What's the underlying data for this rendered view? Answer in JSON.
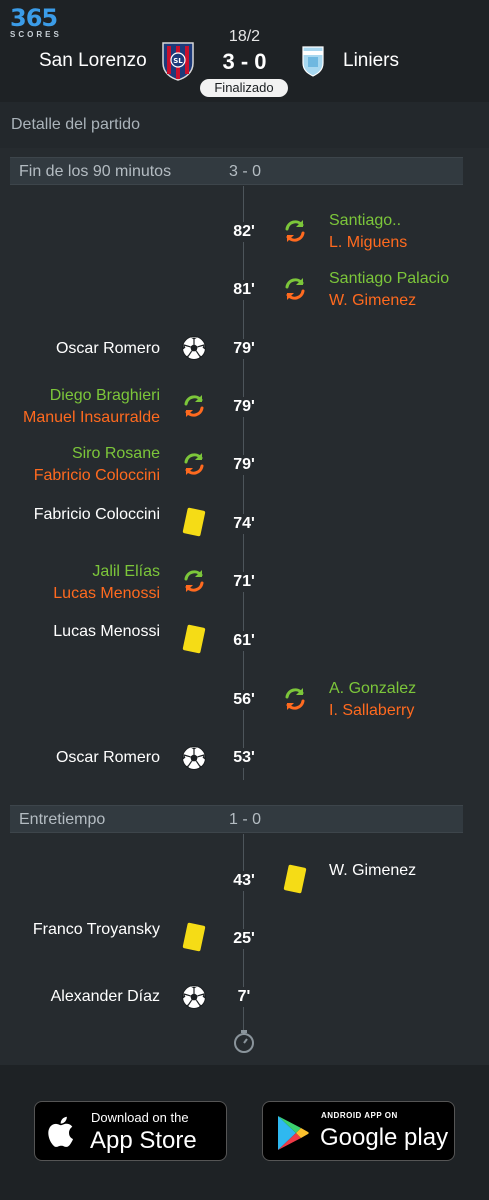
{
  "header": {
    "logo_number": "365",
    "logo_word": "SCORES",
    "date": "18/2",
    "score": "3 - 0",
    "status": "Finalizado",
    "home_team": "San Lorenzo",
    "away_team": "Liniers"
  },
  "section_title": "Detalle del partido",
  "periods": [
    {
      "label": "Fin de los 90 minutos",
      "score": "3 - 0"
    },
    {
      "label": "Entretiempo",
      "score": "1 - 0"
    }
  ],
  "events": [
    {
      "minute": "82'",
      "side": "away",
      "type": "substitution",
      "in": "Santiago..",
      "out": "L. Miguens"
    },
    {
      "minute": "81'",
      "side": "away",
      "type": "substitution",
      "in": "Santiago Palacio",
      "out": "W. Gimenez"
    },
    {
      "minute": "79'",
      "side": "home",
      "type": "goal",
      "player": "Oscar Romero"
    },
    {
      "minute": "79'",
      "side": "home",
      "type": "substitution",
      "in": "Diego Braghieri",
      "out": "Manuel Insaurralde"
    },
    {
      "minute": "79'",
      "side": "home",
      "type": "substitution",
      "in": "Siro Rosane",
      "out": "Fabricio Coloccini"
    },
    {
      "minute": "74'",
      "side": "home",
      "type": "yellow-card",
      "player": "Fabricio Coloccini"
    },
    {
      "minute": "71'",
      "side": "home",
      "type": "substitution",
      "in": "Jalil Elías",
      "out": "Lucas Menossi"
    },
    {
      "minute": "61'",
      "side": "home",
      "type": "yellow-card",
      "player": "Lucas Menossi"
    },
    {
      "minute": "56'",
      "side": "away",
      "type": "substitution",
      "in": "A. Gonzalez",
      "out": "I. Sallaberry"
    },
    {
      "minute": "53'",
      "side": "home",
      "type": "goal",
      "player": "Oscar Romero"
    },
    {
      "minute": "43'",
      "side": "away",
      "type": "yellow-card",
      "player": "W. Gimenez"
    },
    {
      "minute": "25'",
      "side": "home",
      "type": "yellow-card",
      "player": "Franco Troyansky"
    },
    {
      "minute": "7'",
      "side": "home",
      "type": "goal",
      "player": "Alexander Díaz"
    }
  ],
  "footer": {
    "app_store_small": "Download on the",
    "app_store_big": "App Store",
    "play_store_small": "ANDROID APP ON",
    "play_store_big": "Google play"
  },
  "colors": {
    "sub_in": "#7cc63a",
    "sub_out": "#ff6a1f",
    "yellow_card": "#f5dc16",
    "logo_blue": "#3b9ce8"
  }
}
